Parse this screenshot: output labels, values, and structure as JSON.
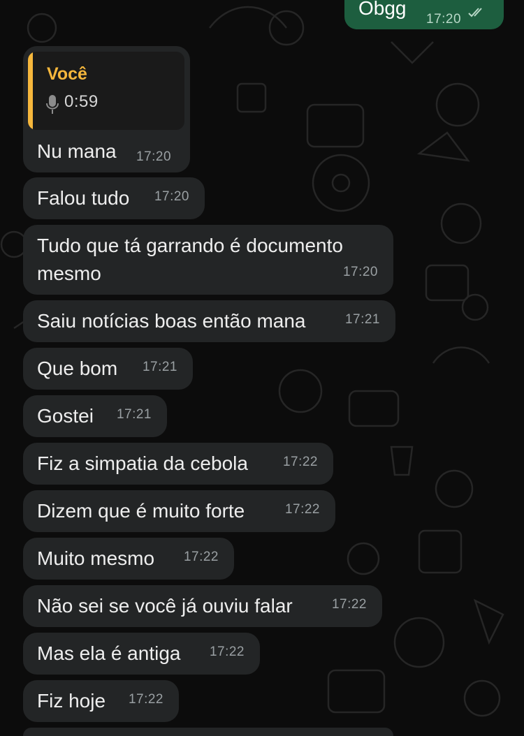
{
  "outgoing": {
    "text": "Obgg",
    "time": "17:20",
    "status": "read-double-check-icon"
  },
  "reply": {
    "quote_author": "Você",
    "quote_duration": "0:59",
    "quote_icon": "mic-icon",
    "text": "Nu mana",
    "time": "17:20"
  },
  "messages": [
    {
      "text": "Falou tudo",
      "time": "17:20"
    },
    {
      "text": "Tudo que tá garrando é documento mesmo",
      "time": "17:20"
    },
    {
      "text": "Saiu notícias boas então mana",
      "time": "17:21"
    },
    {
      "text": "Que bom",
      "time": "17:21"
    },
    {
      "text": "Gostei",
      "time": "17:21"
    },
    {
      "text": "Fiz a simpatia da cebola",
      "time": "17:22"
    },
    {
      "text": "Dizem que é muito forte",
      "time": "17:22"
    },
    {
      "text": "Muito mesmo",
      "time": "17:22"
    },
    {
      "text": "Não sei se você já ouviu falar",
      "time": "17:22"
    },
    {
      "text": "Mas ela é antiga",
      "time": "17:22"
    },
    {
      "text": "Fiz hoje",
      "time": "17:22"
    }
  ],
  "colors": {
    "background": "#0c0c0c",
    "incoming_bubble": "#232526",
    "outgoing_bubble": "#1d5e3f",
    "quote_accent": "#f6b73c"
  }
}
